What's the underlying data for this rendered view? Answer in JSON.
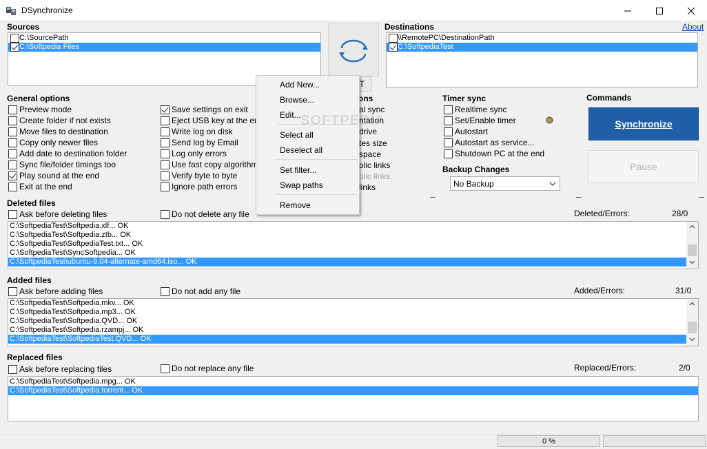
{
  "window": {
    "title": "DSynchronize"
  },
  "sources": {
    "title": "Sources",
    "items": [
      {
        "label": "C:\\SourcePath",
        "checked": false,
        "selected": false
      },
      {
        "label": "C:\\Softpedia Files",
        "checked": true,
        "selected": true
      }
    ]
  },
  "destinations": {
    "title": "Destinations",
    "about": "About",
    "items": [
      {
        "label": "\\\\RemotePC\\DestinationPath",
        "checked": false,
        "selected": false
      },
      {
        "label": "C:\\SoftpediaTest",
        "checked": true,
        "selected": true
      }
    ]
  },
  "general_options": {
    "title": "General options",
    "col1": [
      {
        "label": "Preview mode",
        "checked": false
      },
      {
        "label": "Create folder if not exists",
        "checked": false
      },
      {
        "label": "Move files to destination",
        "checked": false
      },
      {
        "label": "Copy only newer files",
        "checked": false
      },
      {
        "label": "Add date to destination folder",
        "checked": false
      },
      {
        "label": "Sync file/folder timings too",
        "checked": false
      },
      {
        "label": "Play sound at the end",
        "checked": true
      },
      {
        "label": "Exit at the end",
        "checked": false
      }
    ],
    "col2": [
      {
        "label": "Save settings on exit",
        "checked": true
      },
      {
        "label": "Eject USB key at the end",
        "checked": false
      },
      {
        "label": "Write log on disk",
        "checked": false
      },
      {
        "label": "Send log by Email",
        "checked": false
      },
      {
        "label": "Log only errors",
        "checked": false
      },
      {
        "label": "Use fast copy algorithm",
        "checked": false
      },
      {
        "label": "Verify byte to byte",
        "checked": false
      },
      {
        "label": "Ignore path errors",
        "checked": false
      }
    ]
  },
  "special_options": {
    "title_partial": "ons",
    "items": [
      {
        "label": "al sync",
        "disabled": false
      },
      {
        "label": "ntation",
        "disabled": false
      },
      {
        "label": " drive",
        "disabled": false
      },
      {
        "label": "tes size",
        "disabled": false
      },
      {
        "label": " space",
        "disabled": false
      },
      {
        "label": "olic links",
        "disabled": false
      },
      {
        "label": "olic links",
        "disabled": true
      },
      {
        "label": "links",
        "disabled": false
      }
    ]
  },
  "context_menu": {
    "items": [
      "Add New...",
      "Browse...",
      "Edit...",
      "Select all",
      "Deselect all",
      "Set filter...",
      "Swap paths",
      "Remove"
    ],
    "watermark": "SOFTPEDIA"
  },
  "partial_button": {
    "label": "T"
  },
  "timer_sync": {
    "title": "Timer sync",
    "items": [
      {
        "label": "Realtime sync",
        "checked": false
      },
      {
        "label": "Set/Enable timer",
        "checked": false
      },
      {
        "label": "Autostart",
        "checked": false
      },
      {
        "label": "Autostart as service...",
        "checked": false
      },
      {
        "label": "Shutdown PC at the end",
        "checked": false
      }
    ]
  },
  "backup_changes": {
    "title": "Backup Changes",
    "selected": "No Backup"
  },
  "commands": {
    "title": "Commands",
    "synchronize": "Synchronize",
    "pause": "Pause"
  },
  "deleted": {
    "title": "Deleted files",
    "ask": "Ask before deleting files",
    "dont": "Do not delete any file",
    "stat_label": "Deleted/Errors:",
    "stat_value": "28/0",
    "rows": [
      {
        "text": "C:\\SoftpediaTest\\Softpedia.xlf... OK",
        "selected": false
      },
      {
        "text": "C:\\SoftpediaTest\\Softpedia.ztb... OK",
        "selected": false
      },
      {
        "text": "C:\\SoftpediaTest\\SoftpediaTest.txt... OK",
        "selected": false
      },
      {
        "text": "C:\\SoftpediaTest\\SyncSoftpedia... OK",
        "selected": false
      },
      {
        "text": "C:\\SoftpediaTest\\ubuntu-9.04-alternate-amd64.iso... OK",
        "selected": true
      }
    ]
  },
  "added": {
    "title": "Added files",
    "ask": "Ask before adding files",
    "dont": "Do not add any file",
    "stat_label": "Added/Errors:",
    "stat_value": "31/0",
    "rows": [
      {
        "text": "C:\\SoftpediaTest\\Softpedia.mkv... OK",
        "selected": false
      },
      {
        "text": "C:\\SoftpediaTest\\Softpedia.mp3... OK",
        "selected": false
      },
      {
        "text": "C:\\SoftpediaTest\\Softpedia.QVD... OK",
        "selected": false
      },
      {
        "text": "C:\\SoftpediaTest\\Softpedia.rzampj... OK",
        "selected": false
      },
      {
        "text": "C:\\SoftpediaTest\\SoftpediaTest.QVD... OK",
        "selected": true
      }
    ]
  },
  "replaced": {
    "title": "Replaced files",
    "ask": "Ask before replacing files",
    "dont": "Do not replace any file",
    "stat_label": "Replaced/Errors:",
    "stat_value": "2/0",
    "rows": [
      {
        "text": "C:\\SoftpediaTest\\Softpedia.mpg... OK",
        "selected": false
      },
      {
        "text": "C:\\SoftpediaTest\\Softpedia.torrent... OK",
        "selected": true
      }
    ]
  },
  "status": {
    "progress_label": "0 %",
    "progress": 0
  },
  "colors": {
    "selection": "#3399ff",
    "primary_button": "#1f5fa8"
  }
}
